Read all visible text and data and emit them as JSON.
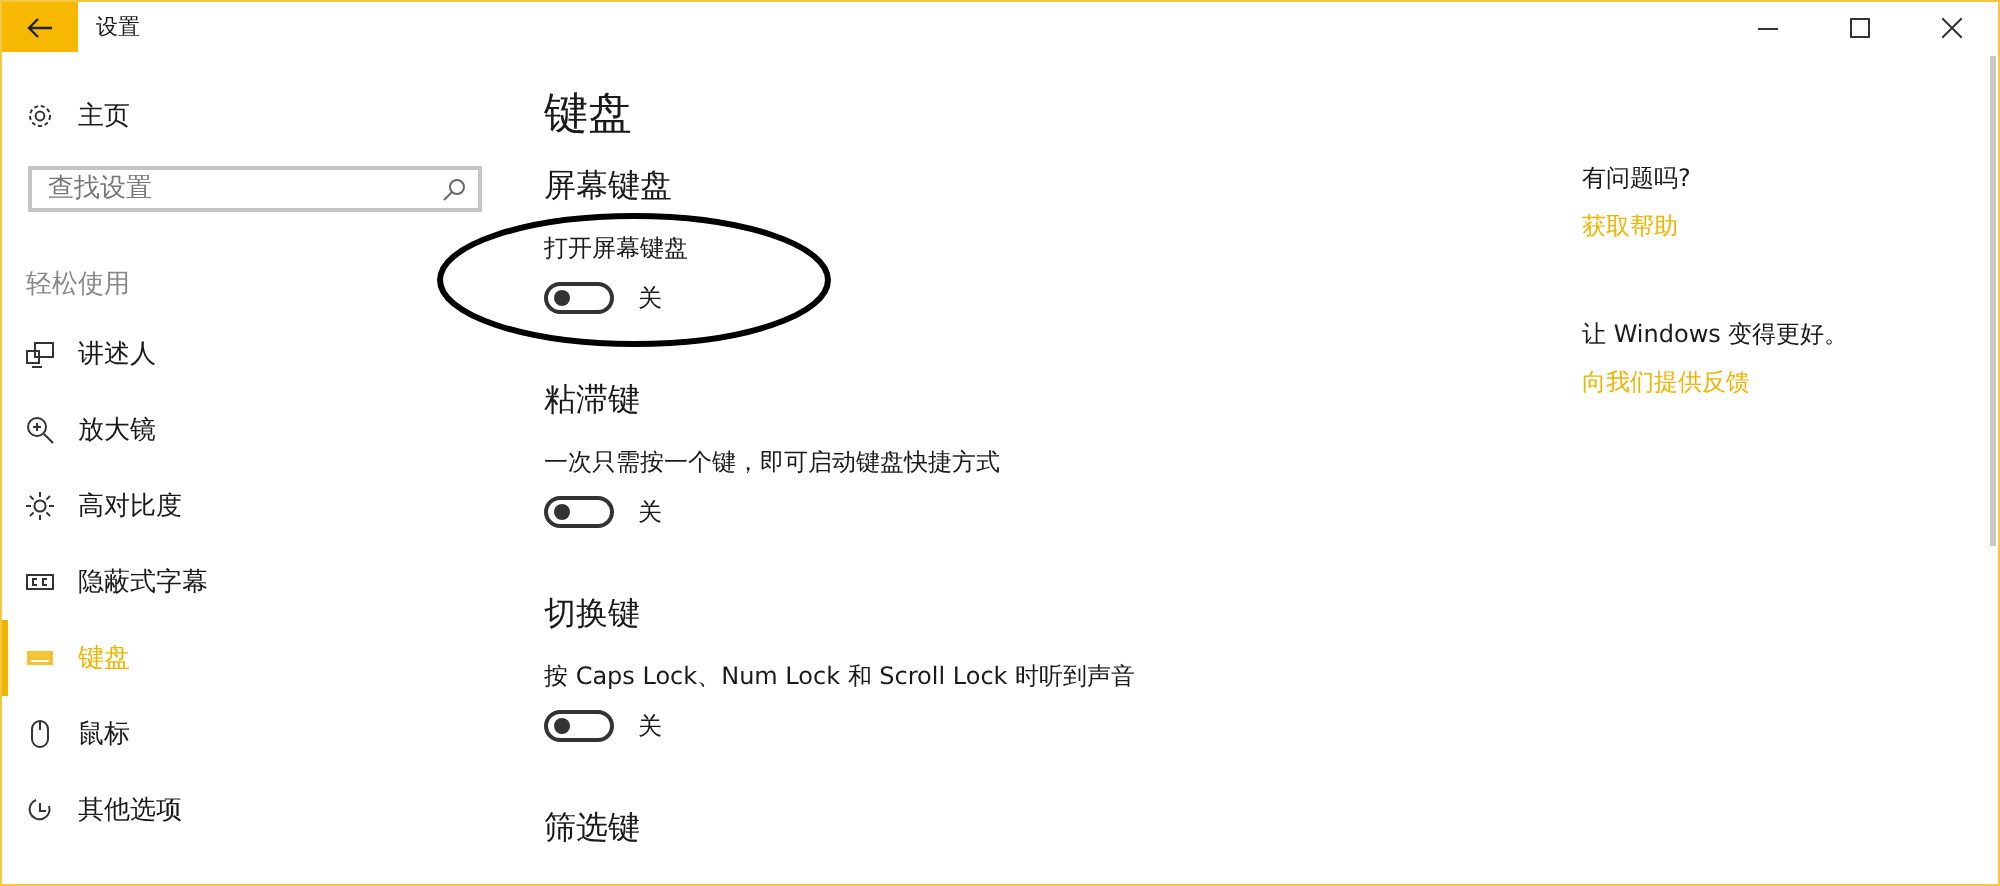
{
  "window": {
    "title": "设置"
  },
  "sidebar": {
    "home": {
      "label": "主页"
    },
    "search": {
      "placeholder": "查找设置"
    },
    "section_title": "轻松使用",
    "items": [
      {
        "kind": "narrator",
        "label": "讲述人",
        "selected": false
      },
      {
        "kind": "magnifier",
        "label": "放大镜",
        "selected": false
      },
      {
        "kind": "contrast",
        "label": "高对比度",
        "selected": false
      },
      {
        "kind": "captions",
        "label": "隐蔽式字幕",
        "selected": false
      },
      {
        "kind": "keyboard",
        "label": "键盘",
        "selected": true
      },
      {
        "kind": "mouse",
        "label": "鼠标",
        "selected": false
      },
      {
        "kind": "other",
        "label": "其他选项",
        "selected": false
      }
    ]
  },
  "main": {
    "title": "键盘",
    "sections": [
      {
        "heading": "屏幕键盘",
        "settings": [
          {
            "label": "打开屏幕键盘",
            "on": false,
            "state_text": "关"
          }
        ]
      },
      {
        "heading": "粘滞键",
        "settings": [
          {
            "label": "一次只需按一个键，即可启动键盘快捷方式",
            "on": false,
            "state_text": "关"
          }
        ]
      },
      {
        "heading": "切换键",
        "settings": [
          {
            "label": "按 Caps Lock、Num Lock 和 Scroll Lock 时听到声音",
            "on": false,
            "state_text": "关"
          }
        ]
      },
      {
        "heading": "筛选键"
      }
    ]
  },
  "aside": {
    "help": {
      "question": "有问题吗?",
      "link": "获取帮助"
    },
    "feedback": {
      "text": "让 Windows 变得更好。",
      "link": "向我们提供反馈"
    }
  }
}
